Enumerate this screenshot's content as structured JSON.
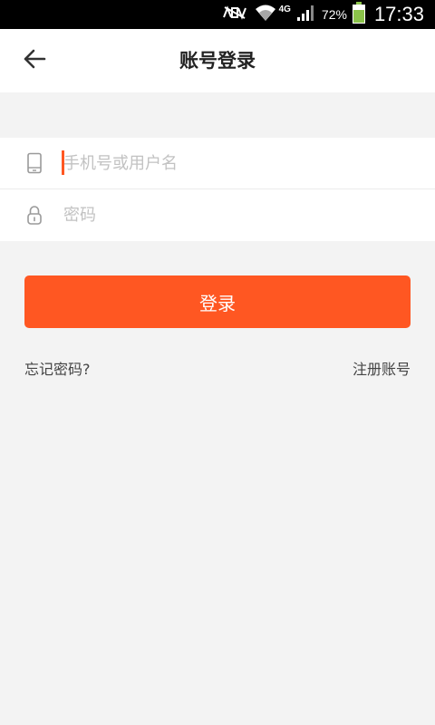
{
  "status_bar": {
    "network": "4G",
    "battery_percent": "72%",
    "time": "17:33",
    "icons": [
      "mute-icon",
      "wifi-icon",
      "signal-icon",
      "battery-icon"
    ]
  },
  "header": {
    "back_icon": "back-arrow-icon",
    "title": "账号登录"
  },
  "form": {
    "username": {
      "icon": "phone-icon",
      "value": "",
      "placeholder": "手机号或用户名"
    },
    "password": {
      "icon": "lock-icon",
      "value": "",
      "placeholder": "密码"
    }
  },
  "actions": {
    "login_label": "登录",
    "forgot_label": "忘记密码?",
    "register_label": "注册账号"
  },
  "colors": {
    "accent": "#ff5722",
    "background": "#f3f3f3",
    "status_bar": "#000000",
    "battery": "#8bc34a"
  }
}
